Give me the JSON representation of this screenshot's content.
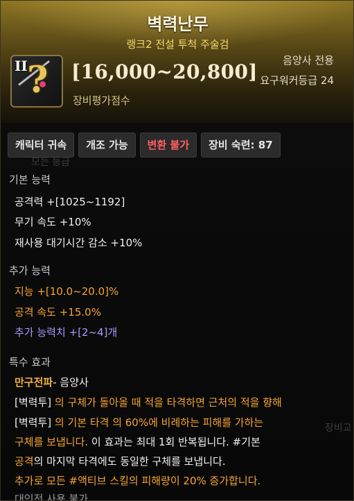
{
  "item": {
    "name": "벽력난무",
    "subtitle": "랭크2 전설 투척 주술검",
    "rank_numeral": "II",
    "icon_glyph": "?",
    "score_range": "[16,000~20,800]",
    "score_label": "장비평가점수",
    "class_only": "음양사 전용",
    "required_level": "요구워커등급 24"
  },
  "tags": [
    {
      "label": "캐릭터 귀속"
    },
    {
      "label": "개조 가능"
    },
    {
      "label": "변환 불가"
    },
    {
      "label": "장비 숙련: 87"
    }
  ],
  "basic": {
    "header": "기본 능력",
    "lines": [
      "공격력 +[1025~1192]",
      "무기 속도 +10%",
      "재사용 대기시간 감소 +10%"
    ]
  },
  "additional": {
    "header": "추가 능력",
    "lines": [
      "지능 +[10.0~20.0]%",
      "공격 속도 +15.0%",
      "추가 능력치 +[2~4]개"
    ]
  },
  "special": {
    "header": "특수 효과",
    "skill_name": "만구전파",
    "skill_suffix": "- 음양사",
    "desc": {
      "l1a": "[벽력투]",
      "l1b": " 의 구체가 돌아올 때 적을 타격하면 근처의 적을 향해",
      "l2a": "[벽력투]",
      "l2b": " 의 기본 타격",
      "l2c": " 의 60%에 비례하는 피해를 가하는",
      "l3a": "구체를 보냅니다.",
      "l3b": " 이 효과는 최대 1회 반복됩니다. #기본",
      "l4a": "공격",
      "l4b": "의 마지막 타격에도 동일한 구체를 보냅니다.",
      "l5": "추가로 모든 #액티브 스킬의 피해량이 20% 증가합니다.",
      "l6": "대인전 사용 불가"
    }
  },
  "background_ghost": {
    "a": "모든 등급",
    "b": "장비교"
  },
  "colors": {
    "accent_gold": "#f0b23c",
    "red_tag": "#ff5f5f",
    "purple": "#a89cff"
  }
}
